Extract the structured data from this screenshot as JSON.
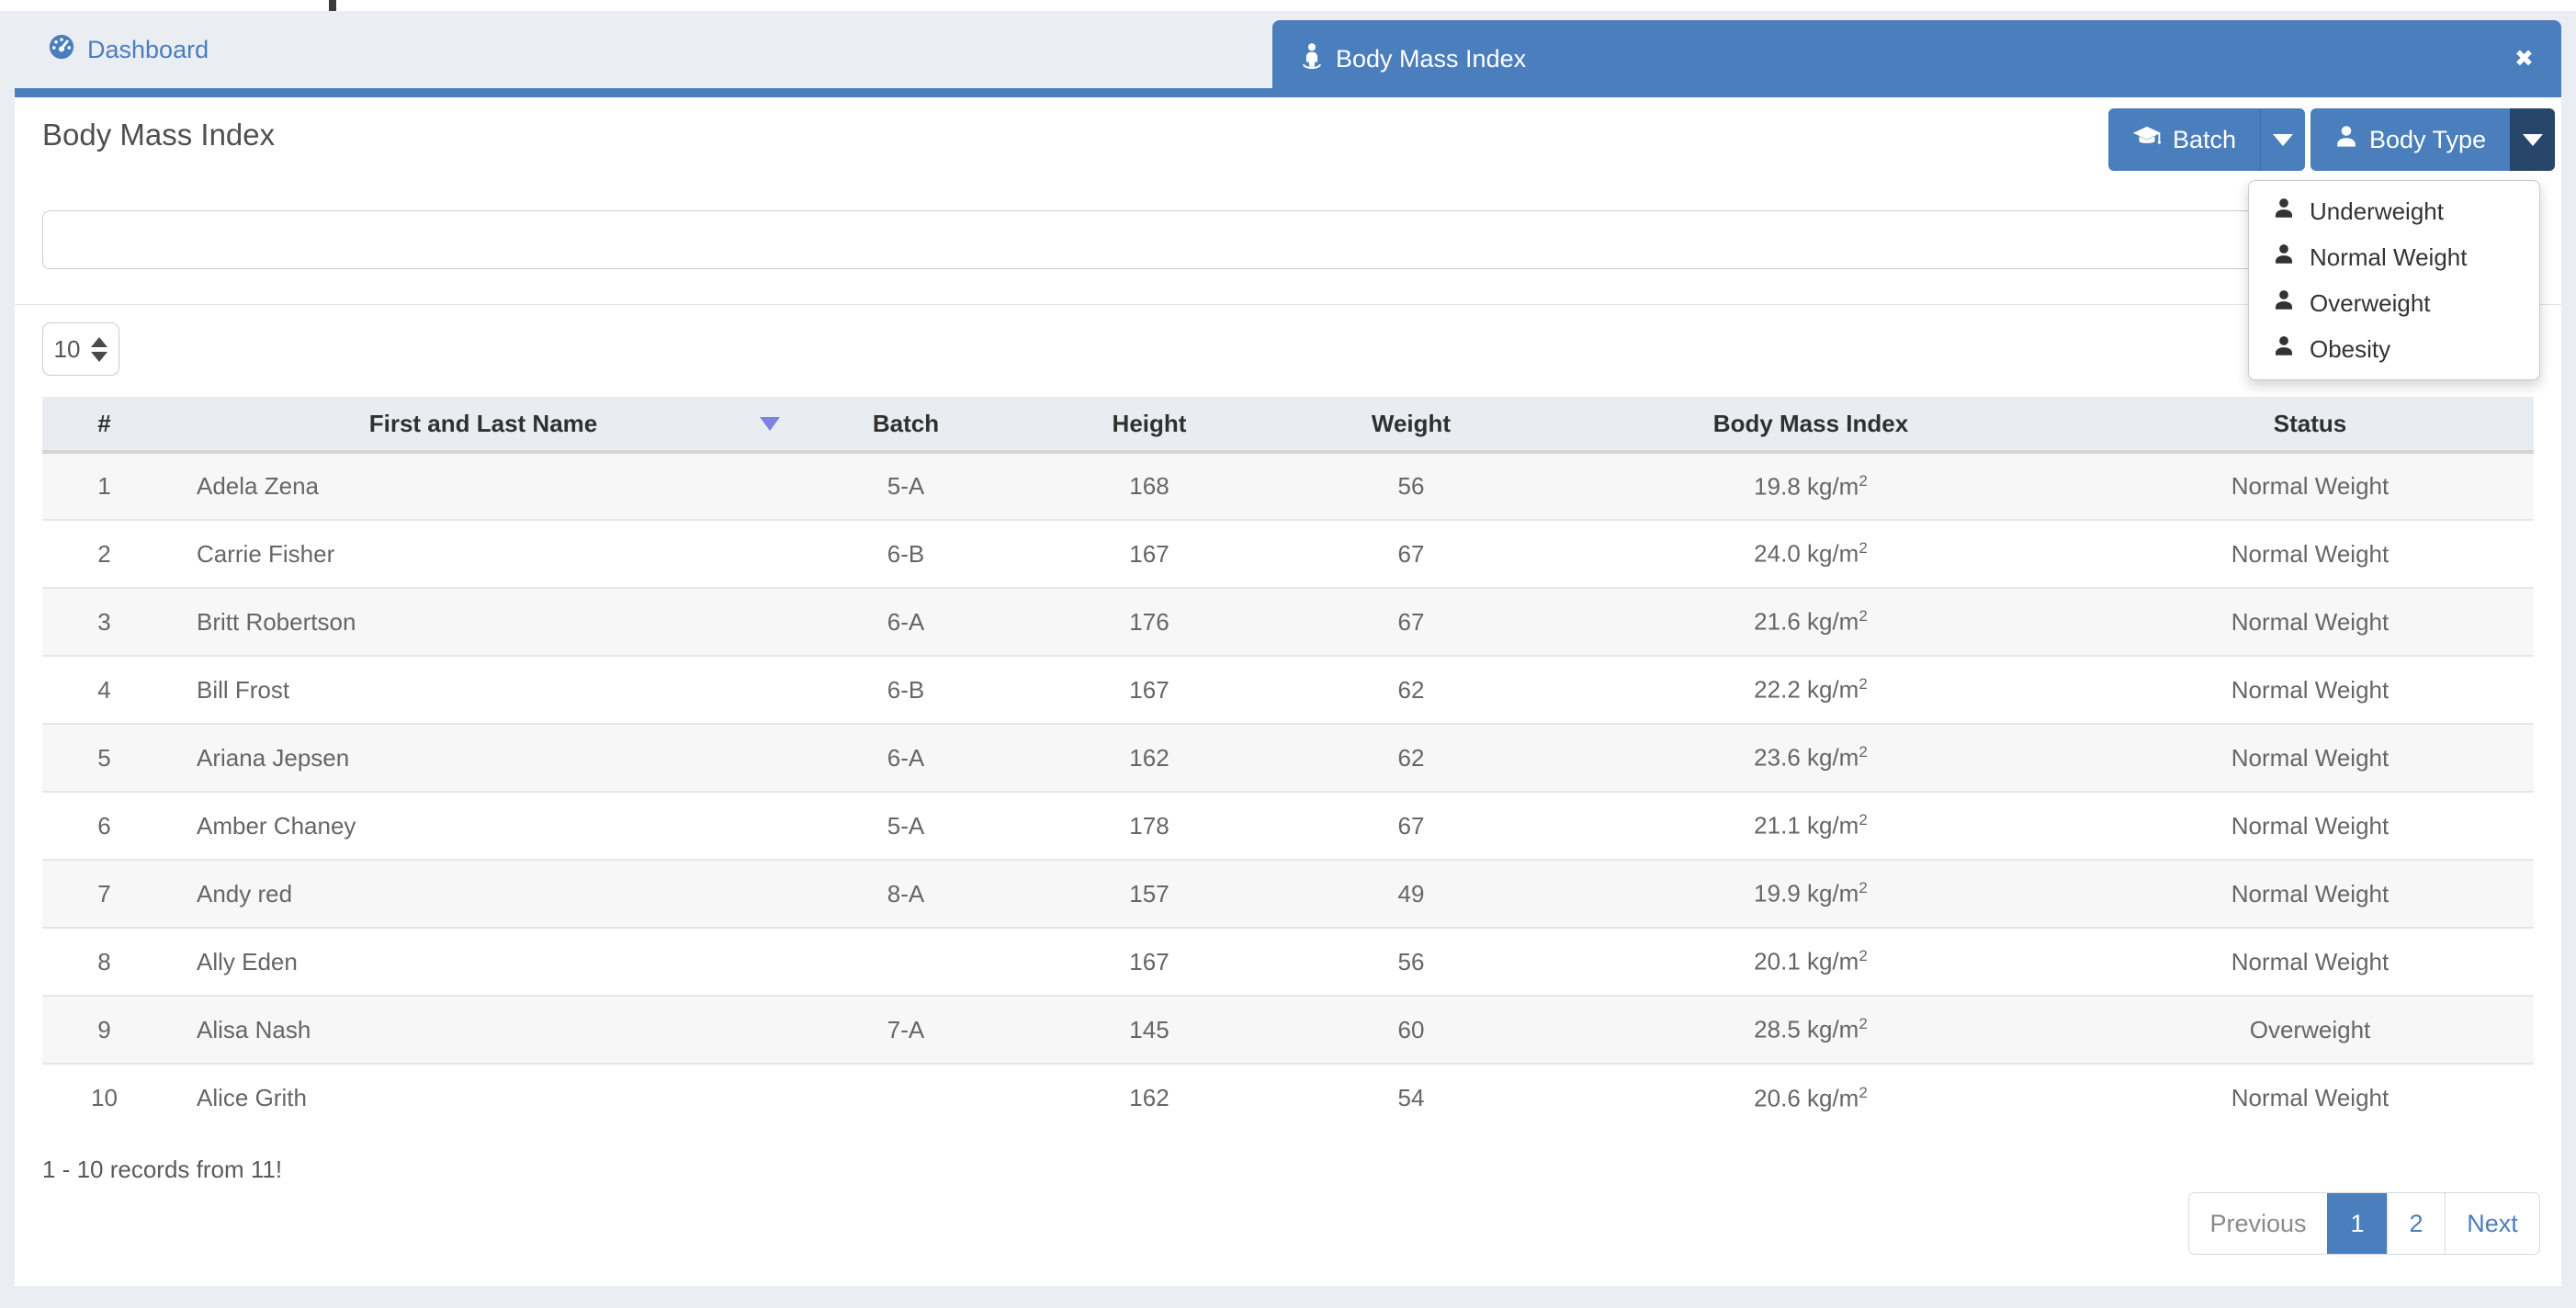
{
  "colors": {
    "accent": "#4a7ebc",
    "accent_dark": "#27466a",
    "tab_bar_bg": "#eaedf2",
    "table_header_bg": "#e9edf2",
    "row_stripe": "#f7f7f8",
    "sort_arrow": "#7d82dd",
    "body_text": "#666666",
    "header_text": "#303030"
  },
  "tabs": {
    "dashboard": {
      "label": "Dashboard"
    },
    "bmi": {
      "label": "Body Mass Index"
    }
  },
  "page": {
    "title": "Body Mass Index"
  },
  "toolbar": {
    "batch_label": "Batch",
    "body_type_label": "Body Type",
    "body_type_menu": [
      "Underweight",
      "Normal Weight",
      "Overweight",
      "Obesity"
    ]
  },
  "filter": {
    "value": "",
    "placeholder": ""
  },
  "page_size": {
    "value": "10"
  },
  "table": {
    "columns": [
      "#",
      "First and Last Name",
      "Batch",
      "Height",
      "Weight",
      "Body Mass Index",
      "Status"
    ],
    "sort": {
      "column": "First and Last Name",
      "direction": "desc"
    },
    "bmi_unit": "kg/m",
    "bmi_exponent": "2",
    "rows": [
      {
        "num": "1",
        "name": "Adela Zena",
        "batch": "5-A",
        "height": "168",
        "weight": "56",
        "bmi": "19.8",
        "status": "Normal Weight"
      },
      {
        "num": "2",
        "name": "Carrie Fisher",
        "batch": "6-B",
        "height": "167",
        "weight": "67",
        "bmi": "24.0",
        "status": "Normal Weight"
      },
      {
        "num": "3",
        "name": "Britt Robertson",
        "batch": "6-A",
        "height": "176",
        "weight": "67",
        "bmi": "21.6",
        "status": "Normal Weight"
      },
      {
        "num": "4",
        "name": "Bill Frost",
        "batch": "6-B",
        "height": "167",
        "weight": "62",
        "bmi": "22.2",
        "status": "Normal Weight"
      },
      {
        "num": "5",
        "name": "Ariana Jepsen",
        "batch": "6-A",
        "height": "162",
        "weight": "62",
        "bmi": "23.6",
        "status": "Normal Weight"
      },
      {
        "num": "6",
        "name": "Amber Chaney",
        "batch": "5-A",
        "height": "178",
        "weight": "67",
        "bmi": "21.1",
        "status": "Normal Weight"
      },
      {
        "num": "7",
        "name": "Andy red",
        "batch": "8-A",
        "height": "157",
        "weight": "49",
        "bmi": "19.9",
        "status": "Normal Weight"
      },
      {
        "num": "8",
        "name": "Ally Eden",
        "batch": "",
        "height": "167",
        "weight": "56",
        "bmi": "20.1",
        "status": "Normal Weight"
      },
      {
        "num": "9",
        "name": "Alisa Nash",
        "batch": "7-A",
        "height": "145",
        "weight": "60",
        "bmi": "28.5",
        "status": "Overweight"
      },
      {
        "num": "10",
        "name": "Alice Grith",
        "batch": "",
        "height": "162",
        "weight": "54",
        "bmi": "20.6",
        "status": "Normal Weight"
      }
    ]
  },
  "footer": {
    "records_text": "1 - 10 records from 11!",
    "pagination": [
      {
        "label": "Previous",
        "state": "disabled",
        "cls": "pg-prev"
      },
      {
        "label": "1",
        "state": "active",
        "cls": "pg-1"
      },
      {
        "label": "2",
        "state": "normal",
        "cls": "pg-2"
      },
      {
        "label": "Next",
        "state": "normal",
        "cls": "pg-next"
      }
    ]
  }
}
